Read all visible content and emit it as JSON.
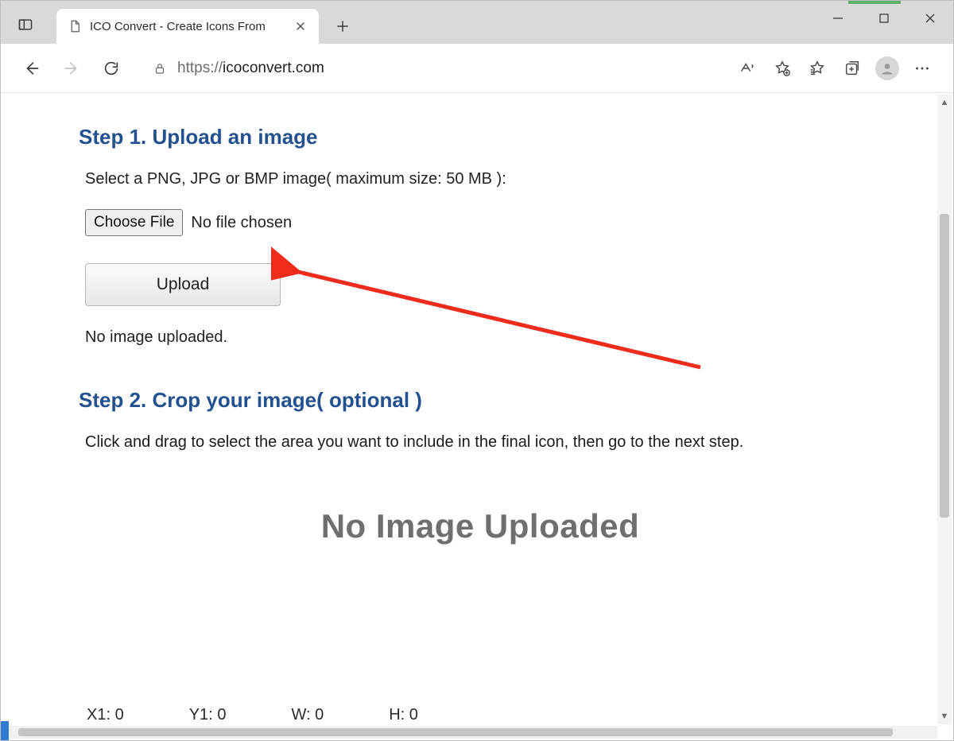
{
  "browser": {
    "tab_title": "ICO Convert - Create Icons From",
    "url_prefix": "https://",
    "url_host": "icoconvert.com"
  },
  "page": {
    "step1_heading": "Step 1. Upload an image",
    "step1_help": "Select a PNG, JPG or BMP image( maximum size: 50 MB ):",
    "choose_file_label": "Choose File",
    "file_status": "No file chosen",
    "upload_label": "Upload",
    "upload_status": "No image uploaded.",
    "step2_heading": "Step 2. Crop your image( optional )",
    "step2_help": "Click and drag to select the area you want to include in the final icon, then go to the next step.",
    "no_image_big": "No Image Uploaded",
    "coords": {
      "x1_label": "X1:",
      "x1_val": "0",
      "y1_label": "Y1:",
      "y1_val": "0",
      "w_label": "W:",
      "w_val": "0",
      "h_label": "H:",
      "h_val": "0"
    }
  }
}
